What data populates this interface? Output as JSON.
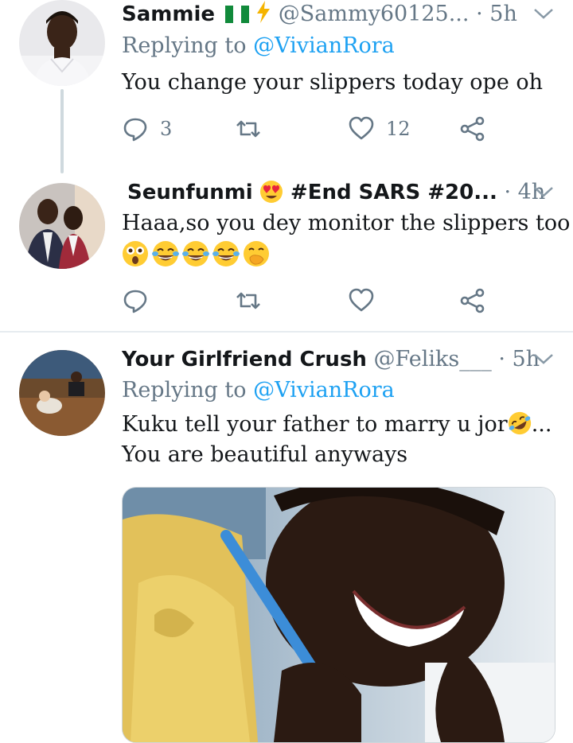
{
  "tweets": [
    {
      "name": "Sammie",
      "handle": "@Sammy60125...",
      "separator": "·",
      "time": "5h",
      "replying_label": "Replying to",
      "replying_handle": "@VivianRora",
      "text": "You change your slippers today ope oh",
      "reply_count": "3",
      "like_count": "12"
    },
    {
      "name": "Seunfunmi",
      "name_suffix": "#End SARS #20...",
      "separator": "·",
      "time": "4h",
      "text": "Haaa,so you dey monitor the slippers too"
    },
    {
      "name": "Your Girlfriend Crush",
      "handle": "@Feliks___",
      "separator": "·",
      "time": "5h",
      "replying_label": "Replying to",
      "replying_handle": "@VivianRora",
      "text_line1": "Kuku tell your father to marry u jor",
      "text_line1_end": "...",
      "text_line2": "You are beautiful anyways"
    }
  ],
  "colors": {
    "link": "#1da1f2",
    "muted": "#657786",
    "text": "#14171a",
    "divider": "#e6ecf0"
  },
  "icons": [
    "reply-icon",
    "retweet-icon",
    "like-icon",
    "share-icon",
    "chevron-down-icon",
    "nigeria-flag-icon",
    "lightning-icon",
    "heart-eyes-emoji",
    "astonished-emoji",
    "tears-of-joy-emoji",
    "hand-over-mouth-emoji",
    "rolling-laughing-emoji"
  ]
}
